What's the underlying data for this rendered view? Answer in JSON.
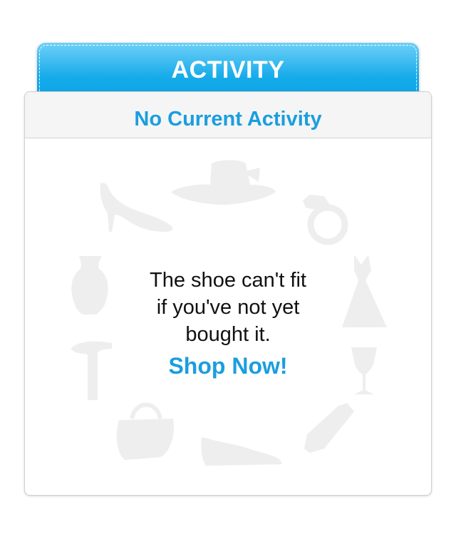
{
  "tab": {
    "title": "ACTIVITY"
  },
  "card": {
    "heading": "No Current Activity",
    "message_lines": [
      "The shoe can't fit",
      "if you've not yet",
      "bought it."
    ],
    "cta_label": "Shop Now!"
  },
  "decorations": {
    "icons": [
      "hat-icon",
      "ring-icon",
      "dress-icon",
      "wine-glass-icon",
      "tie-icon",
      "shoe-icon",
      "handbag-icon",
      "hammer-icon",
      "vase-icon",
      "high-heel-icon"
    ],
    "color": "#eeeeee"
  },
  "colors": {
    "accent": "#1a9ede",
    "tab_top": "#6ed0f7",
    "tab_bottom": "#0aa2e4"
  }
}
